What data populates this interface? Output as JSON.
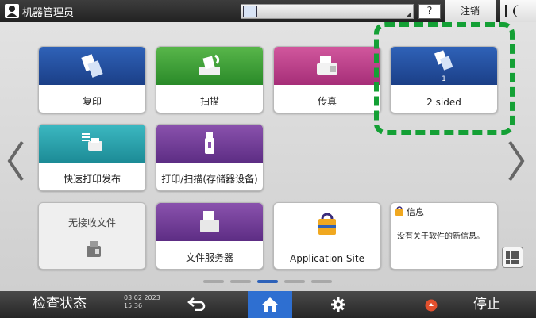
{
  "topbar": {
    "user_name": "机器管理员",
    "help_label": "?",
    "logout_label": "注销"
  },
  "apps": [
    {
      "label": "复印",
      "icon": "copy-icon",
      "color": "#2f62b8"
    },
    {
      "label": "扫描",
      "icon": "scanner-icon",
      "color": "#58b64a"
    },
    {
      "label": "传真",
      "icon": "fax-icon",
      "color": "#d1579d"
    },
    {
      "label": "2 sided",
      "number": "1",
      "icon": "copy-shortcut-icon",
      "color": "#2f62b8"
    },
    {
      "label": "快速打印发布",
      "icon": "printer-icon",
      "color": "#3cb8c1"
    },
    {
      "label": "打印/扫描(存储器设备)",
      "icon": "usb-icon",
      "color": "#8a52ad"
    },
    {
      "label": "无接收文件",
      "icon": "fax-document-icon"
    },
    {
      "label": "文件服务器",
      "icon": "document-server-icon",
      "color": "#8a52ad"
    },
    {
      "label": "Application Site",
      "icon": "shopping-bag-icon"
    }
  ],
  "info_widget": {
    "title": "信息",
    "message": "没有关于软件的新信息。"
  },
  "pagination": {
    "pages": 5,
    "current": 3
  },
  "bottombar": {
    "status_label": "检查状态",
    "date": "03 02 2023",
    "time": "15:36",
    "stop_label": "停止"
  },
  "colors": {
    "highlight": "#14a035",
    "accent": "#2e6fd1"
  }
}
